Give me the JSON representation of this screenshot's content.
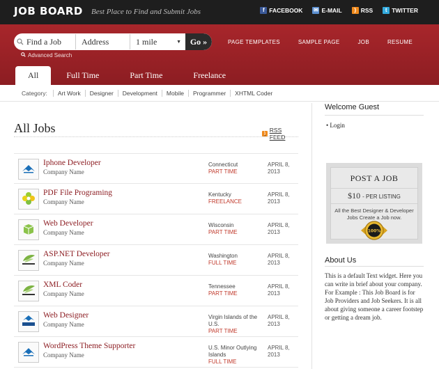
{
  "header": {
    "logo": "JOB BOARD",
    "tagline": "Best Place to Find and Submit Jobs",
    "social": [
      {
        "label": "FACEBOOK",
        "icon": "facebook-icon"
      },
      {
        "label": "E-MAIL",
        "icon": "email-icon"
      },
      {
        "label": "RSS",
        "icon": "rss-icon"
      },
      {
        "label": "TWITTER",
        "icon": "twitter-icon"
      }
    ]
  },
  "search": {
    "keyword_value": "Find a Job",
    "address_value": "Address",
    "radius_value": "1 mile",
    "go_label": "Go »",
    "advanced_label": "Advanced Search"
  },
  "topnav": [
    "PAGE TEMPLATES",
    "SAMPLE PAGE",
    "JOB",
    "RESUME"
  ],
  "tabs": [
    {
      "label": "All",
      "active": true
    },
    {
      "label": "Full Time"
    },
    {
      "label": "Part Time"
    },
    {
      "label": "Freelance"
    }
  ],
  "category": {
    "label": "Category:",
    "items": [
      "Art Work",
      "Designer",
      "Development",
      "Mobile",
      "Programmer",
      "XHTML Coder"
    ]
  },
  "main": {
    "title": "All Jobs",
    "rss_label": "RSS FEED",
    "jobs": [
      {
        "title": "Iphone Developer",
        "company": "Company Name",
        "location": "Connecticut",
        "type": "PART TIME",
        "date1": "APRIL 8,",
        "date2": "2013",
        "logo": "bird"
      },
      {
        "title": "PDF File Programing",
        "company": "Company Name",
        "location": "Kentucky",
        "type": "FREELANCE",
        "date1": "APRIL 8,",
        "date2": "2013",
        "logo": "flower"
      },
      {
        "title": "Web Developer",
        "company": "Company Name",
        "location": "Wisconsin",
        "type": "PART TIME",
        "date1": "APRIL 8,",
        "date2": "2013",
        "logo": "cube"
      },
      {
        "title": "ASP.NET Developer",
        "company": "Company Name",
        "location": "Washington",
        "type": "FULL TIME",
        "date1": "APRIL 8,",
        "date2": "2013",
        "logo": "leaf"
      },
      {
        "title": "XML Coder",
        "company": "Company Name",
        "location": "Tennessee",
        "type": "PART TIME",
        "date1": "APRIL 8,",
        "date2": "2013",
        "logo": "leaf"
      },
      {
        "title": "Web Designer",
        "company": "Company Name",
        "location": "Virgin Islands of the U.S.",
        "type": "PART TIME",
        "date1": "APRIL 8,",
        "date2": "2013",
        "logo": "safir"
      },
      {
        "title": "WordPress Theme Supporter",
        "company": "Company Name",
        "location": "U.S. Minor Outlying Islands",
        "type": "FULL TIME",
        "date1": "APRIL 8,",
        "date2": "2013",
        "logo": "bird"
      }
    ]
  },
  "sidebar": {
    "welcome": "Welcome Guest",
    "login": "Login",
    "postjob": {
      "title": "POST A JOB",
      "price": "$10",
      "per": "- PER LISTING",
      "desc": "All the Best Designer & Developer Jobs Create a Job now.",
      "badge_text": "100%"
    },
    "about_title": "About Us",
    "about_text": "This is a default Text widget. Here you can write in brief about your company. For Example : This Job Board is for Job Providers and Job Seekers. It is all about giving someone a career footstep or getting a dream job."
  }
}
